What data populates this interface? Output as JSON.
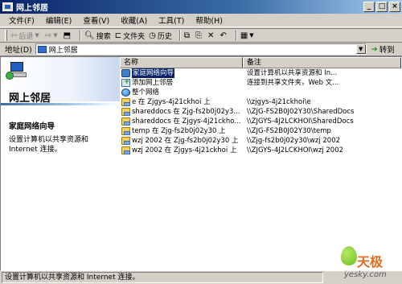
{
  "window": {
    "title": "网上邻居"
  },
  "menu": [
    "文件(F)",
    "编辑(E)",
    "查看(V)",
    "收藏(A)",
    "工具(T)",
    "帮助(H)"
  ],
  "toolbar": {
    "back": "后退",
    "search": "搜索",
    "folders": "文件夹",
    "history": "历史"
  },
  "address": {
    "label": "地址(D)",
    "value": "网上邻居",
    "go": "转到"
  },
  "left_pane": {
    "title": "网上邻居",
    "selected_name": "家庭网络向导",
    "selected_desc": "设置计算机以共享资源和 Internet 连接。"
  },
  "list": {
    "columns": [
      "名称",
      "备注"
    ],
    "rows": [
      {
        "icon": "wizard-icon",
        "name": "家庭网络向导",
        "desc": "设置计算机以共享资源和 In...",
        "selected": true
      },
      {
        "icon": "add-place-icon",
        "name": "添加网上邻居",
        "desc": "连接到共享文件夹，Web 文...",
        "selected": false
      },
      {
        "icon": "entire-network-icon",
        "name": "整个网络",
        "desc": "",
        "selected": false
      },
      {
        "icon": "network-share-icon",
        "name": "e 在 Zjgys-4j21ckhoi 上",
        "desc": "\\\\zjgys-4j21ckhoi\\e",
        "selected": false
      },
      {
        "icon": "network-share-icon",
        "name": "shareddocs 在 Zjg-fs2b0j02y3...",
        "desc": "\\\\ZJG-FS2B0J02Y30\\SharedDocs",
        "selected": false
      },
      {
        "icon": "network-share-icon",
        "name": "shareddocs 在 Zjgys-4j21ckho...",
        "desc": "\\\\ZJGYS-4J2LCKHOI\\SharedDocs",
        "selected": false
      },
      {
        "icon": "network-share-icon",
        "name": "temp 在 Zjg-fs2b0j02y30 上",
        "desc": "\\\\ZJG-FS2B0J02Y30\\temp",
        "selected": false
      },
      {
        "icon": "network-share-icon",
        "name": "wzj 2002 在 Zjg-fs2b0j02y30 上",
        "desc": "\\\\Zjg-fs2b0j02y30\\wzj 2002",
        "selected": false
      },
      {
        "icon": "network-share-icon",
        "name": "wzj 2002 在 Zjgys-4j21ckhoi 上",
        "desc": "\\\\ZJGYS-4J2LCKHOI\\wzj 2002",
        "selected": false
      }
    ]
  },
  "status": {
    "text": "设置计算机以共享资源和 Internet 连接。"
  },
  "watermark": {
    "brand": "天极",
    "site": "yesky.com"
  }
}
